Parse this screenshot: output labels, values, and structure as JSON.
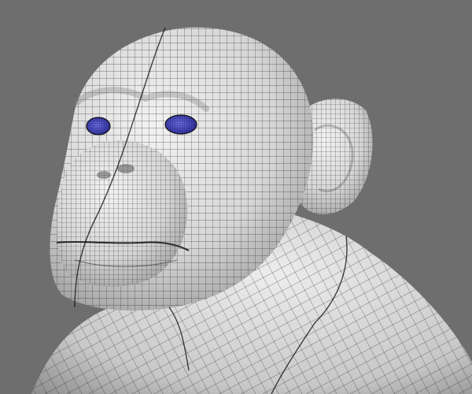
{
  "viewport": {
    "background_color": "#6e6e6e",
    "shading_mode": "wireframe-on-shaded",
    "model": {
      "subject": "chimpanzee-bust",
      "surface_color": "#d9d9d9",
      "wire_color": "#1e1e1e",
      "eye_color": "#3a3ab0",
      "parts": [
        "head-mesh",
        "ear-mesh",
        "neck-mesh",
        "left-eye-mesh",
        "right-eye-mesh",
        "nostrils",
        "mouth-line",
        "seam-lines"
      ]
    }
  }
}
